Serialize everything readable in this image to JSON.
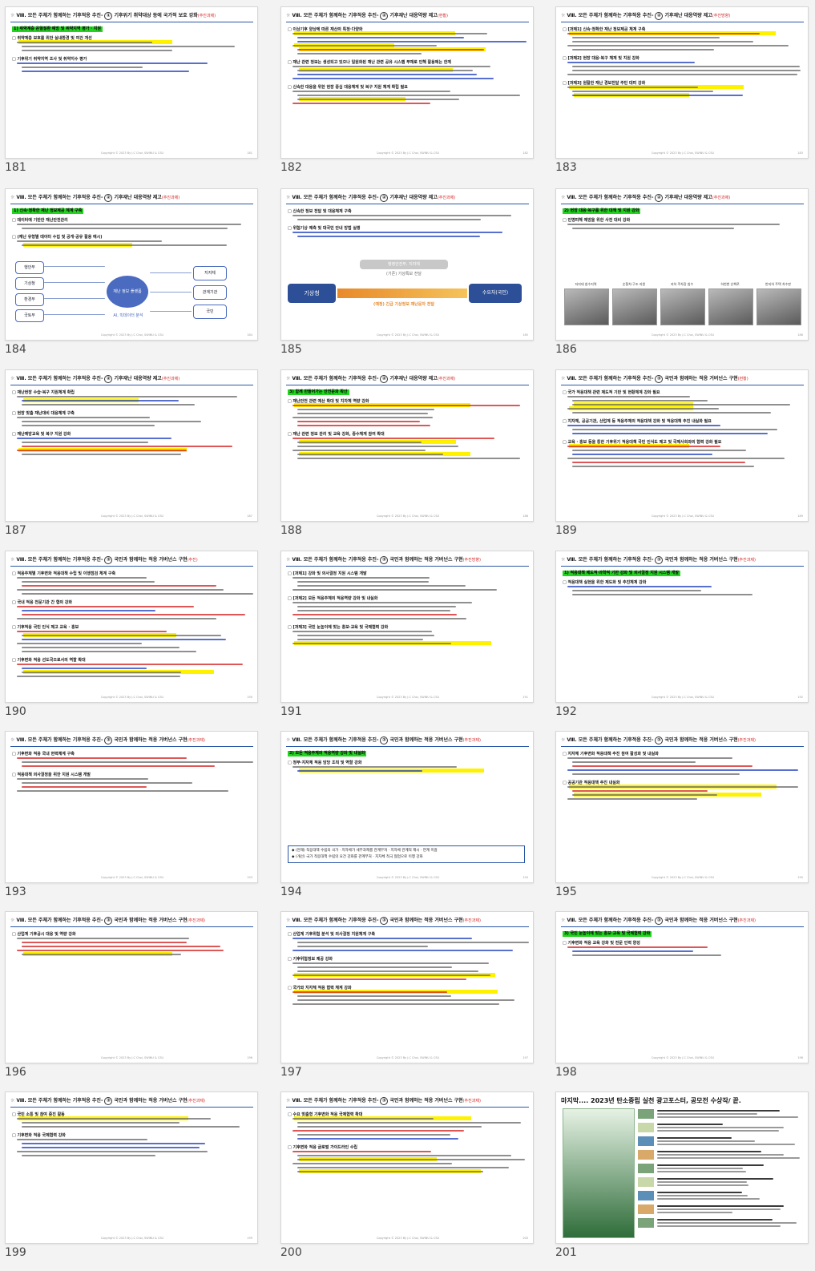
{
  "slides": [
    {
      "num": "181",
      "variant": 1,
      "section": "①",
      "title": "기후위기 취약대상 등에 국가적 보호 강화",
      "tag": "(추진과제)",
      "green": "1) 취약계층 온열질환 예방 및 취약지역 평가 · 지원",
      "subheads": [
        "취약계층 보호를 위한 실내환경 및 여건 개선",
        "기후위기 취약지역 조사 및 취약지수 평가"
      ]
    },
    {
      "num": "182",
      "variant": 2,
      "section": "②",
      "title": "기후재난 대응역량 제고",
      "tag": "(현황)",
      "green": "",
      "subheads": [
        "이상기후 양상에 따른 재산의 특정·다양화",
        "재난 관련 정보는 생성되고 있으나 일원화된 재난 관련 공유 시스템 부재로 인해 활용에는 한계",
        "신속한 대응을 위한 현장 중심 대응체계 및 복구 지원 체계 확립 필요"
      ]
    },
    {
      "num": "183",
      "variant": 3,
      "section": "②",
      "title": "기후재난 대응역량 제고",
      "tag": "(추진방향)",
      "green": "",
      "subheads": [
        "[과제1] 신속·정확한 재난 정보제공 체계 구축",
        "[과제2] 현장 대응·복구 체계 및 지원 강화",
        "[과제3] 원활한 재난 경보전달 주민 대피 강화"
      ]
    },
    {
      "num": "184",
      "variant": 4,
      "section": "②",
      "title": "기후재난 대응역량 제고",
      "tag": "(추진과제)",
      "green": "1) 신속·정확한 재난 정보제공 체계 구축",
      "subheads": [
        "데이터에 기반한 재난안전관리",
        "(재난 유형별 데이터 수집 및 공개·공유 활용 예시)"
      ],
      "diagram": {
        "center": "재난 정보 플랫폼",
        "left": [
          "행안부",
          "기상청",
          "환경부",
          "국토부"
        ],
        "right": [
          "지자체",
          "관계기관",
          "국민"
        ],
        "caption": "AI, 빅데이터 분석"
      }
    },
    {
      "num": "185",
      "variant": 5,
      "section": "②",
      "title": "기후재난 대응역량 제고",
      "tag": "(추진과제)",
      "green": "",
      "subheads": [
        "신속한 정보 전달 및 대응체계 구축",
        "위험기상 예측 및 대국민 안내 방법 실행"
      ],
      "flow": {
        "from": "기상청",
        "mid_top": "행정안전부, 지자체",
        "mid_sub": "(기존) 기상특보 전달",
        "mid_bottom": "(예정) 긴급 기상정보 재난문자 전달",
        "to": "수요자(국민)"
      }
    },
    {
      "num": "186",
      "variant": 6,
      "section": "②",
      "title": "기후재난 대응역량 제고",
      "tag": "(추진과제)",
      "green": "2) 현장 대응·복구를 위한 대책 및 지원 강화",
      "subheads": [
        "인명피해 예방을 위한 사전 대비 강화"
      ],
      "photo_labels": [
        "저지대 침수지역",
        "순찰차·구조 지원",
        "지하 주차장 침수",
        "하천변 산책로",
        "반지하 주택 차수판"
      ]
    },
    {
      "num": "187",
      "variant": 7,
      "section": "②",
      "title": "기후재난 대응역량 제고",
      "tag": "(추진과제)",
      "green": "",
      "subheads": [
        "재난현장 수습·복구 지원체계 확립",
        "현장 맞춤 재난대비 대응체계 구축",
        "재난예방교육 및 복구 지원 강화"
      ]
    },
    {
      "num": "188",
      "variant": 8,
      "section": "②",
      "title": "기후재난 대응역량 제고",
      "tag": "(추진과제)",
      "green": "3) 함께 만들어가는 안전문화 확산",
      "subheads": [
        "재난안전 관련 예산 확대 및 지자체 역량 강화",
        "재난 관련 정보 관리 및 교육 강화, 중수체계 참여 확대"
      ]
    },
    {
      "num": "189",
      "variant": 9,
      "section": "③",
      "title": "국민과 함께하는 적응 거버넌스 구현",
      "tag": "(현황)",
      "green": "",
      "subheads": [
        "국가 적응대책 관련 제도적 기반 및 현황체계 강화 필요",
        "지자체, 공공기관, 산업계 등 적응주체의 적응대책 강화 및 적응대책 추진 내실화 필요",
        "교육 · 홍보 등을 통한 기후위기 적응대책 국민 인식도 제고 및 국제사회와의 협력 강화 필요"
      ]
    },
    {
      "num": "190",
      "variant": 10,
      "section": "③",
      "title": "국민과 함께하는 적응 거버넌스 구현",
      "tag": "(추진)",
      "green": "",
      "subheads": [
        "적응주체별 기후변화 적응대책 수립 및 이행점검 체계 구축",
        "국내 적응 전문기관 간 협의 강화",
        "기후적응 국민 인식 제고 교육 · 홍보",
        "기후변화 적응 선도국으로서의 역할 확대"
      ]
    },
    {
      "num": "191",
      "variant": 11,
      "section": "③",
      "title": "국민과 함께하는 적응 거버넌스 구현",
      "tag": "(추진방향)",
      "green": "",
      "subheads": [
        "[과제1] 강화 및 의사결정 지원 시스템 개발",
        "[과제2] 모든 적응주체의 적응역량 강화 및 내실화",
        "[과제3] 국민 눈높이에 맞는 홍보·교육 및 국제협력 강화"
      ]
    },
    {
      "num": "192",
      "variant": 12,
      "section": "③",
      "title": "국민과 함께하는 적응 거버넌스 구현",
      "tag": "(추진과제)",
      "green": "1) 적응대책 제도적·과학적 기반 강화 및 의사결정 지원 시스템 개발",
      "subheads": [
        "적응대책 실현을 위한 제도화 및 추진체계 강화"
      ]
    },
    {
      "num": "193",
      "variant": 13,
      "section": "③",
      "title": "국민과 함께하는 적응 거버넌스 구현",
      "tag": "(추진과제)",
      "green": "",
      "subheads": [
        "기후변화 적응 국내 현력체계 구축",
        "적응대책 의사결정을 위한 지원 시스템 개발"
      ]
    },
    {
      "num": "194",
      "variant": 14,
      "section": "③",
      "title": "국민과 함께하는 적응 거버넌스 구현",
      "tag": "(추진과제)",
      "green": "2) 모든 적응주체의 적응역량 강화 및 내실화",
      "subheads": [
        "정부·지자체 적응 담당 조직 및 역할 강화"
      ],
      "box_lines": [
        "◆ (현재) 적응대책 수립의 국가 · 지자체가 세부과제를 관계부처 · 지자체 관계적 제시 · 연계 미흡",
        "◆ (개선) 국가 적응대책 수립의 요건 강화를 관계부처 · 지자체 적극 협업으로 이행 강화"
      ]
    },
    {
      "num": "195",
      "variant": 15,
      "section": "③",
      "title": "국민과 함께하는 적응 거버넌스 구현",
      "tag": "(추진과제)",
      "green": "",
      "subheads": [
        "지자체 기후변화 적응대책 추진 참여 활성화 및 내실화",
        "공공기관 적응대책 추진 내실화"
      ]
    },
    {
      "num": "196",
      "variant": 16,
      "section": "③",
      "title": "국민과 함께하는 적응 거버넌스 구현",
      "tag": "(추진과제)",
      "green": "",
      "subheads": [
        "산업계 기후공시 대응 및 역량 강화"
      ]
    },
    {
      "num": "197",
      "variant": 17,
      "section": "③",
      "title": "국민과 함께하는 적응 거버넌스 구현",
      "tag": "(추진과제)",
      "green": "",
      "subheads": [
        "산업계 기후위험 분석 및 의사결정 지원체계 구축",
        "기후위험정보 제공 강화",
        "국가와 지자체 적응 협력 체계 강화"
      ]
    },
    {
      "num": "198",
      "variant": 18,
      "section": "③",
      "title": "국민과 함께하는 적응 거버넌스 구현",
      "tag": "(추진과제)",
      "green": "3) 국민 눈높이에 맞는 홍보·교육 및 국제협력 강화",
      "subheads": [
        "기후변화 적응 교육 강화 및 전문 인력 양성"
      ]
    },
    {
      "num": "199",
      "variant": 19,
      "section": "③",
      "title": "국민과 함께하는 적응 거버넌스 구현",
      "tag": "(추진과제)",
      "green": "",
      "subheads": [
        "국민 소통 및 참여 증진 활동",
        "기후변화 적응 국제협력 강화"
      ]
    },
    {
      "num": "200",
      "variant": 20,
      "section": "③",
      "title": "국민과 함께하는 적응 거버넌스 구현",
      "tag": "(추진과제)",
      "green": "",
      "subheads": [
        "수요 맞춤형 기후변화 적응 국제협력 확대",
        "기후변화 적응 글로벌 가이드라인 수립"
      ]
    },
    {
      "num": "201",
      "variant": 21,
      "title201": "마지막.... 2023년 탄소중립 실천 광고포스터, 공모전 수상작/ 끝."
    }
  ],
  "header_prefix": "Ⅷ. 모든 주체가 함께하는 기후적응 추진-",
  "copyright": "Copyright © 2023 By J.C Choi, SWINU & CSU",
  "colors": {
    "rule": "#2b57a7",
    "green_hl": "#22d41f",
    "yellow_hl": "#fff200",
    "red_text": "#d21f1f",
    "blue_text": "#1f3fbf",
    "tag_red": "#d21f1f",
    "diagram_blue": "#4a6bbf",
    "diagram_orange": "#e8892a"
  }
}
